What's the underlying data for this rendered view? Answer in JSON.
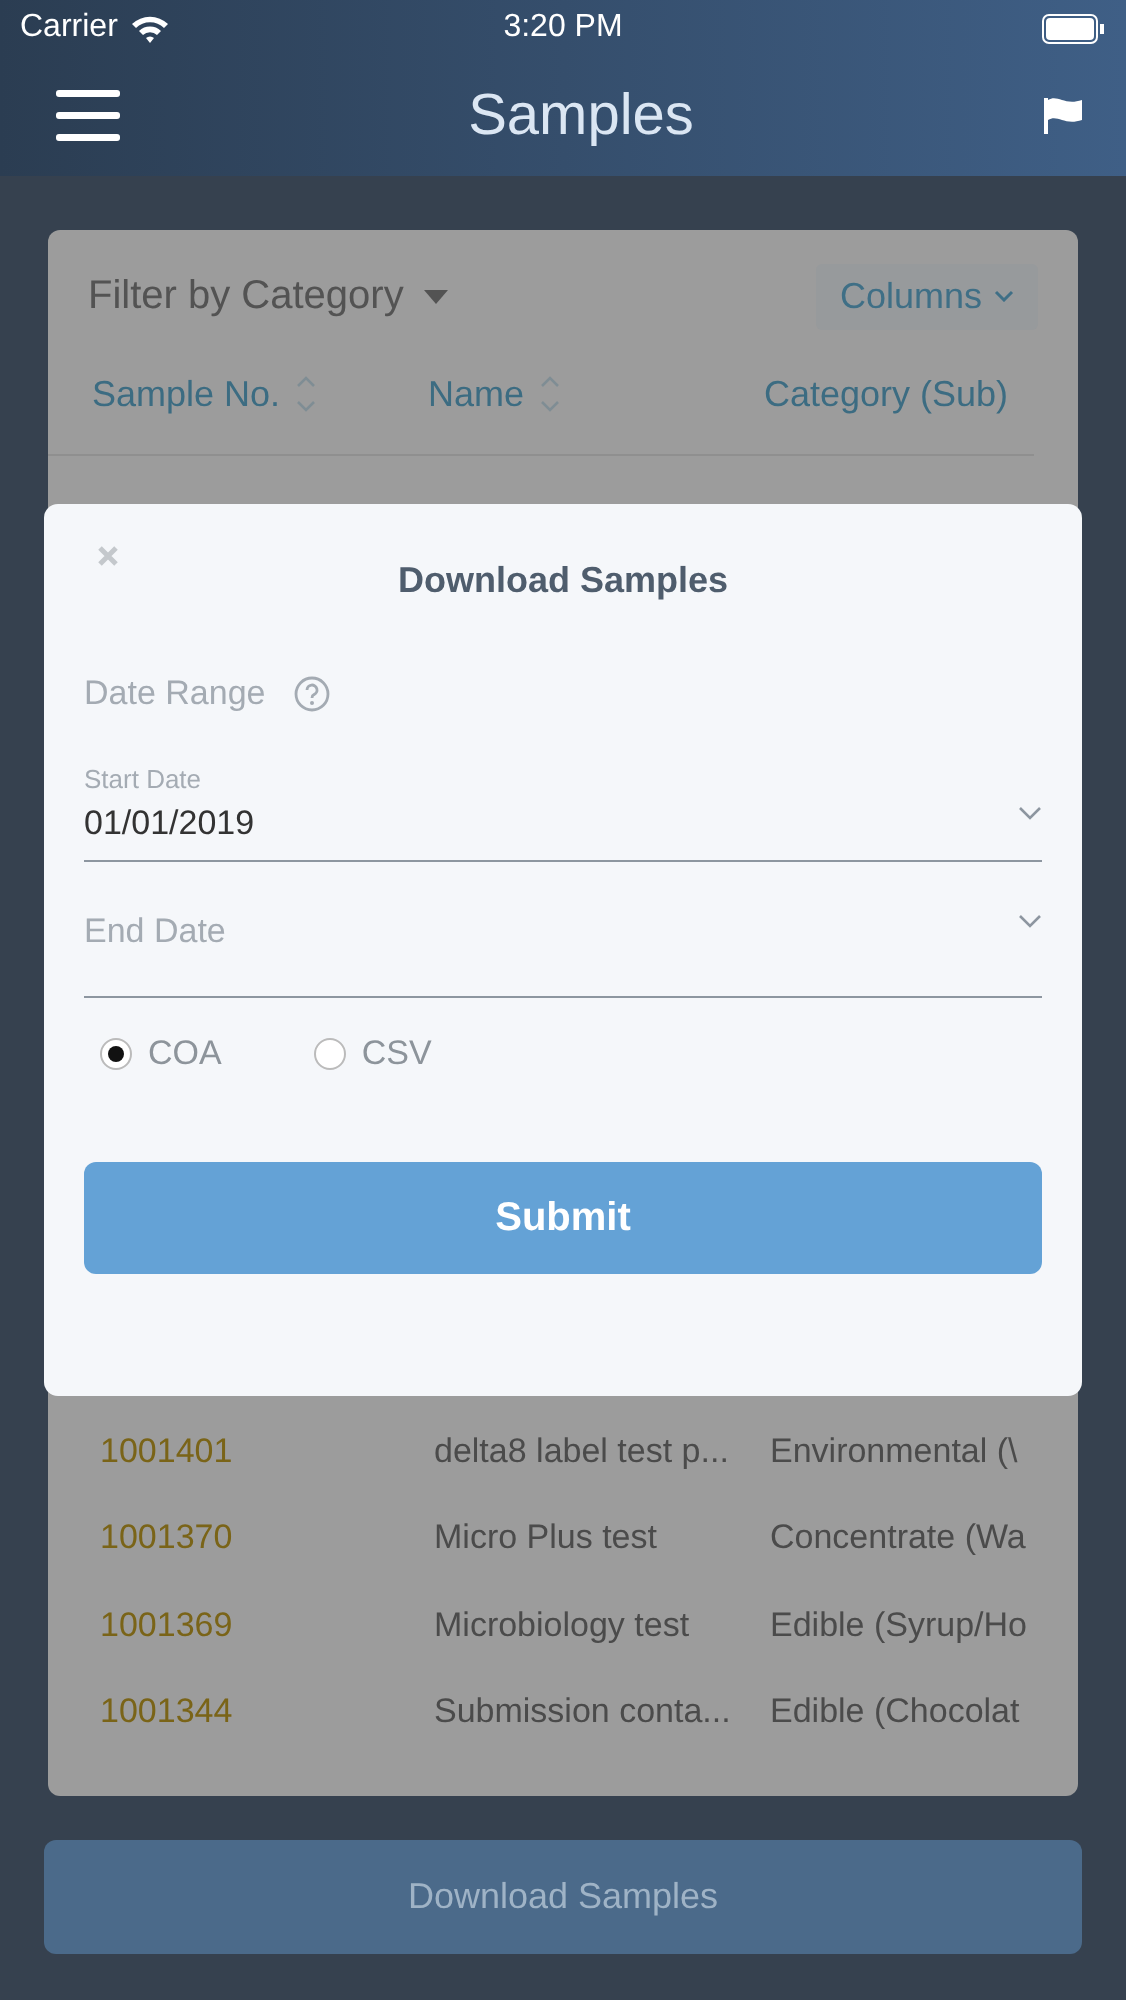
{
  "status_bar": {
    "carrier": "Carrier",
    "time": "3:20 PM"
  },
  "nav": {
    "title": "Samples"
  },
  "table": {
    "filter": "Filter by Category",
    "columns_button": "Columns",
    "columns": [
      {
        "label": "Sample No.",
        "sortable": true
      },
      {
        "label": "Name",
        "sortable": true
      },
      {
        "label": "Category (Sub)",
        "sortable": false
      }
    ],
    "rows": [
      {
        "sample_no": "1001401",
        "name": "delta8 label test p...",
        "category": "Environmental (\\"
      },
      {
        "sample_no": "1001370",
        "name": "Micro Plus test",
        "category": "Concentrate (Wa"
      },
      {
        "sample_no": "1001369",
        "name": "Microbiology test",
        "category": "Edible (Syrup/Ho"
      },
      {
        "sample_no": "1001344",
        "name": "Submission conta...",
        "category": "Edible (Chocolat"
      }
    ]
  },
  "download_button": {
    "label": "Download Samples",
    "disabled": true
  },
  "modal": {
    "title": "Download Samples",
    "date_range_label": "Date Range",
    "fields": [
      {
        "label": "Start Date",
        "value": "01/01/2019"
      },
      {
        "placeholder": "End Date"
      }
    ],
    "formats": [
      {
        "label": "COA",
        "selected": true
      },
      {
        "label": "CSV",
        "selected": false
      }
    ],
    "submit": "Submit"
  }
}
